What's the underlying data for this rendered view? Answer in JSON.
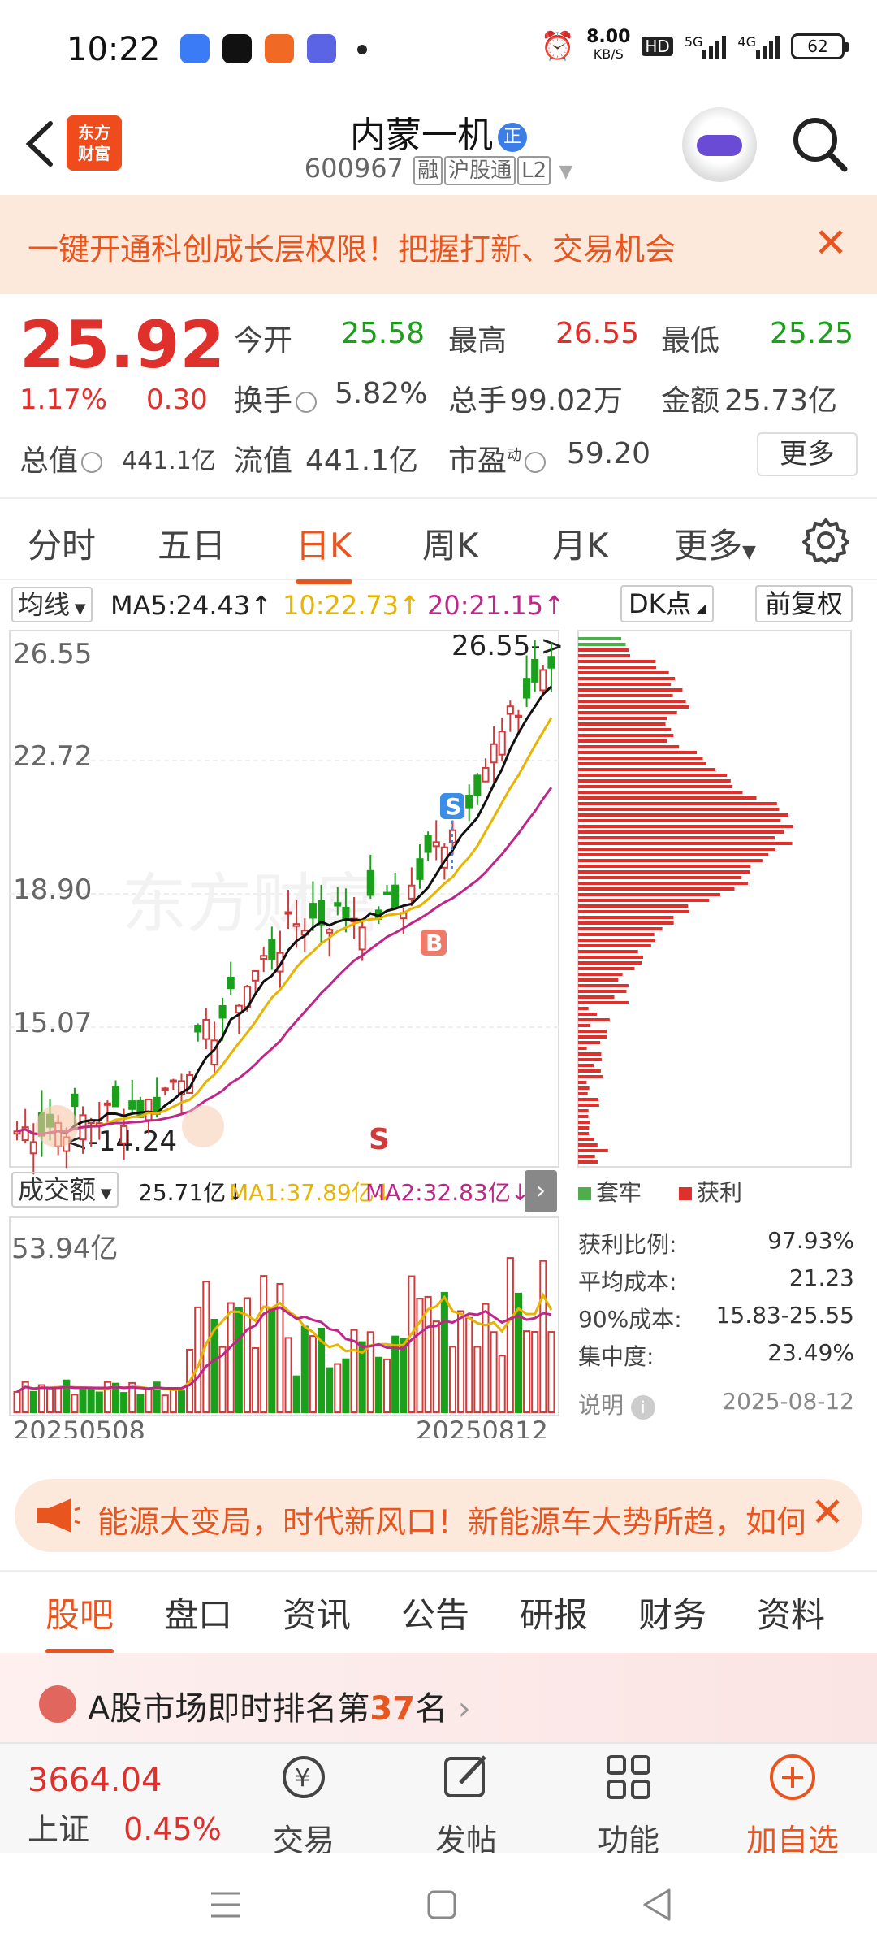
{
  "status_bar": {
    "time": "10:22",
    "net_speed": "8.00",
    "net_unit": "KB/S",
    "hd": "HD",
    "sig1": "5G",
    "sig2": "4G",
    "battery": "62"
  },
  "header": {
    "back": "<",
    "logo_line1": "东方",
    "logo_line2": "财富",
    "name": "内蒙一机",
    "badge": "正",
    "code": "600967",
    "tag1": "融",
    "tag2": "沪股通",
    "tag3": "L2"
  },
  "banner": {
    "text": "一键开通科创成长层权限！把握打新、交易机会",
    "close": "✕"
  },
  "quote": {
    "price": "25.92",
    "pct": "1.17%",
    "change": "0.30",
    "open_label": "今开",
    "open": "25.58",
    "high_label": "最高",
    "high": "26.55",
    "low_label": "最低",
    "low": "25.25",
    "turnover_label": "换手",
    "turnover": "5.82%",
    "volume_label": "总手",
    "volume": "99.02万",
    "amount_label": "金额",
    "amount": "25.73亿",
    "mcap_label": "总值",
    "mcap": "441.1亿",
    "float_label": "流值",
    "float": "441.1亿",
    "pe_label": "市盈",
    "pe_sup": "动",
    "pe": "59.20",
    "more": "更多"
  },
  "tabs": [
    "分时",
    "五日",
    "日K",
    "周K",
    "月K",
    "更多"
  ],
  "ma_bar": {
    "select": "均线",
    "ma5": "MA5:24.43",
    "ma10": "10:22.73",
    "ma20": "20:21.15",
    "dk": "DK点",
    "fq": "前复权"
  },
  "vol_bar": {
    "select": "成交额",
    "v": "25.71亿",
    "ma1": "MA1:37.89亿",
    "ma2": "MA2:32.83亿"
  },
  "chart_labels": {
    "y_ticks": [
      "26.55",
      "22.72",
      "18.90",
      "15.07"
    ],
    "high_marker": "26.55->",
    "low_marker": "<-14.24",
    "vol_max": "53.94亿",
    "date_start": "20250508",
    "date_end": "20250812",
    "sell_marker": "S",
    "buy_marker": "B",
    "s_marker": "S",
    "watermark": "东方财富"
  },
  "chip": {
    "legend_green": "套牢",
    "legend_red": "获利",
    "profit_label": "获利比例:",
    "profit": "97.93%",
    "avg_label": "平均成本:",
    "avg": "21.23",
    "cost90_label": "90%成本:",
    "cost90": "15.83-25.55",
    "conc_label": "集中度:",
    "conc": "23.49%",
    "note_label": "说明",
    "date": "2025-08-12"
  },
  "news": {
    "text": "能源大变局，时代新风口！新能源车大势所趋，如何",
    "close": "✕"
  },
  "bottom_tabs": [
    "股吧",
    "盘口",
    "资讯",
    "公告",
    "研报",
    "财务",
    "资料"
  ],
  "rank": {
    "pre": "A股市场即时排名第",
    "num": "37",
    "post": "名",
    "arrow": "›"
  },
  "footer": {
    "index_value": "3664.04",
    "index_name": "上证",
    "index_pct": "0.45%",
    "trade": "交易",
    "post": "发帖",
    "func": "功能",
    "add": "加自选"
  },
  "colors": {
    "accent": "#e9551f",
    "up": "#e0302c",
    "down": "#1aa01a"
  }
}
